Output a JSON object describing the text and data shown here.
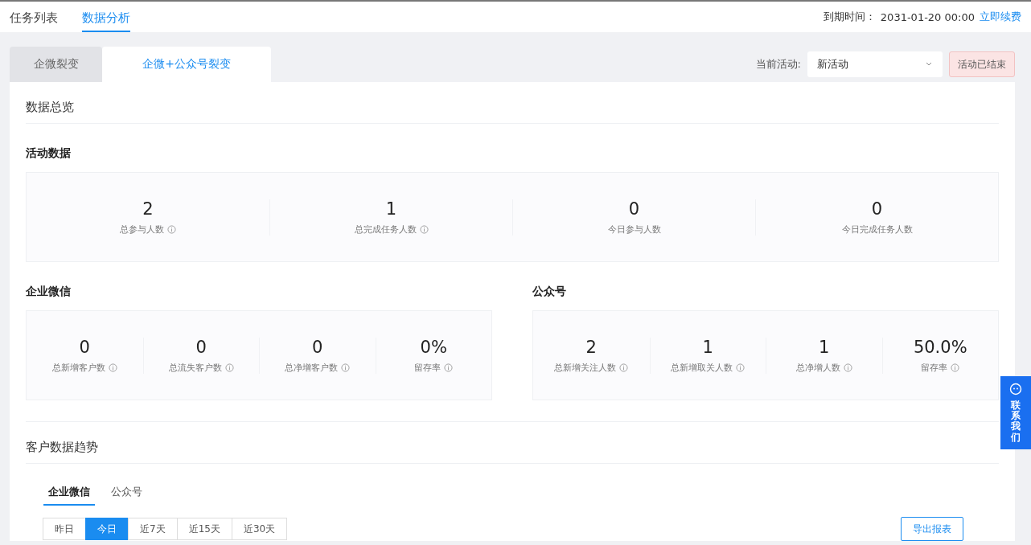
{
  "top_tabs": [
    {
      "label": "任务列表",
      "selected": false
    },
    {
      "label": "数据分析",
      "selected": true
    }
  ],
  "expiry": {
    "label": "到期时间：",
    "value": "2031-01-20 00:00",
    "link": "立即续费"
  },
  "sub_tabs": [
    {
      "label": "企微裂变",
      "selected": false
    },
    {
      "label": "企微+公众号裂变",
      "selected": true
    }
  ],
  "activity_filter": {
    "label": "当前活动:",
    "value": "新活动",
    "status": "活动已结束"
  },
  "overview_title": "数据总览",
  "activity": {
    "title": "活动数据",
    "stats": [
      {
        "value": "2",
        "label": "总参与人数",
        "info": true
      },
      {
        "value": "1",
        "label": "总完成任务人数",
        "info": true
      },
      {
        "value": "0",
        "label": "今日参与人数",
        "info": false
      },
      {
        "value": "0",
        "label": "今日完成任务人数",
        "info": false
      }
    ]
  },
  "wecom": {
    "title": "企业微信",
    "stats": [
      {
        "value": "0",
        "label": "总新增客户数",
        "info": true
      },
      {
        "value": "0",
        "label": "总流失客户数",
        "info": true
      },
      {
        "value": "0",
        "label": "总净增客户数",
        "info": true
      },
      {
        "value": "0%",
        "label": "留存率",
        "info": true
      }
    ]
  },
  "official": {
    "title": "公众号",
    "stats": [
      {
        "value": "2",
        "label": "总新增关注人数",
        "info": true
      },
      {
        "value": "1",
        "label": "总新增取关人数",
        "info": true
      },
      {
        "value": "1",
        "label": "总净增人数",
        "info": true
      },
      {
        "value": "50.0%",
        "label": "留存率",
        "info": true
      }
    ]
  },
  "trend": {
    "title": "客户数据趋势",
    "tabs": [
      {
        "label": "企业微信",
        "selected": true
      },
      {
        "label": "公众号",
        "selected": false
      }
    ],
    "ranges": [
      {
        "label": "昨日",
        "selected": false
      },
      {
        "label": "今日",
        "selected": true
      },
      {
        "label": "近7天",
        "selected": false
      },
      {
        "label": "近15天",
        "selected": false
      },
      {
        "label": "近30天",
        "selected": false
      }
    ],
    "export": "导出报表"
  },
  "contact": "联系我们"
}
